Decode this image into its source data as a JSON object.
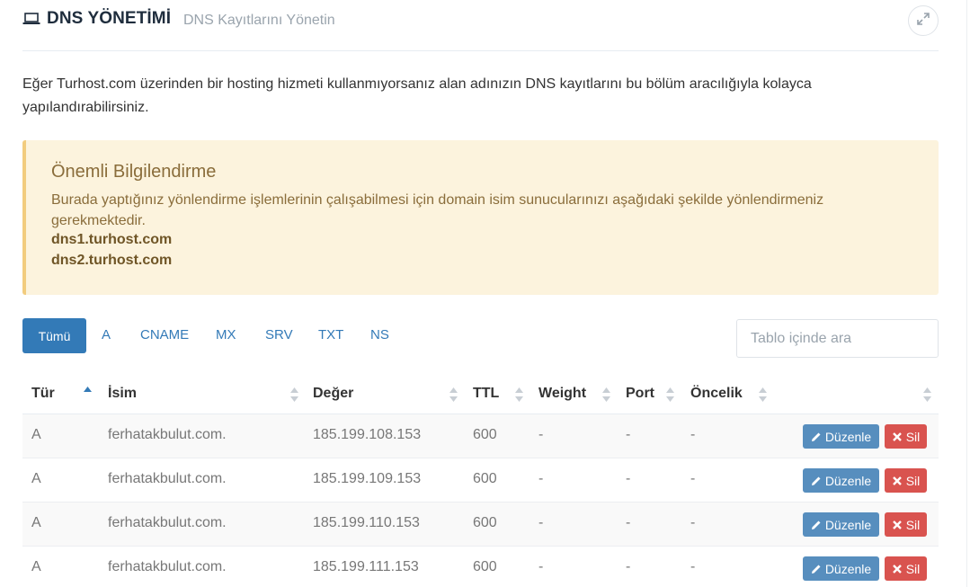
{
  "header": {
    "title": "DNS YÖNETİMİ",
    "subtitle": "DNS Kayıtlarını Yönetin",
    "icon": "laptop-icon",
    "expand_icon": "expand-icon"
  },
  "intro": "Eğer Turhost.com üzerinden bir hosting hizmeti kullanmıyorsanız alan adınızın DNS kayıtlarını bu bölüm aracılığıyla kolayca yapılandırabilirsiniz.",
  "alert": {
    "title": "Önemli Bilgilendirme",
    "text": "Burada yaptığınız yönlendirme işlemlerinin çalışabilmesi için domain isim sunucularınızı aşağıdaki şekilde yönlendirmeniz gerekmektedir.",
    "ns1": "dns1.turhost.com",
    "ns2": "dns2.turhost.com"
  },
  "filters": [
    "Tümü",
    "A",
    "CNAME",
    "MX",
    "SRV",
    "TXT",
    "NS"
  ],
  "search": {
    "placeholder": "Tablo içinde ara"
  },
  "table": {
    "headers": [
      "Tür",
      "İsim",
      "Değer",
      "TTL",
      "Weight",
      "Port",
      "Öncelik"
    ],
    "sorted_column": "Tür",
    "rows": [
      {
        "type": "A",
        "name": "ferhatakbulut.com.",
        "value": "185.199.108.153",
        "ttl": "600",
        "weight": "-",
        "port": "-",
        "priority": "-"
      },
      {
        "type": "A",
        "name": "ferhatakbulut.com.",
        "value": "185.199.109.153",
        "ttl": "600",
        "weight": "-",
        "port": "-",
        "priority": "-"
      },
      {
        "type": "A",
        "name": "ferhatakbulut.com.",
        "value": "185.199.110.153",
        "ttl": "600",
        "weight": "-",
        "port": "-",
        "priority": "-"
      },
      {
        "type": "A",
        "name": "ferhatakbulut.com.",
        "value": "185.199.111.153",
        "ttl": "600",
        "weight": "-",
        "port": "-",
        "priority": "-"
      }
    ],
    "edit_label": "Düzenle",
    "delete_label": "Sil",
    "edit_icon": "pencil-icon",
    "delete_icon": "times-icon"
  },
  "colors": {
    "primary": "#337ab7",
    "edit_button": "#578ebe",
    "delete_button": "#d9534f",
    "alert_bg": "#fcf3dd",
    "alert_border": "#f2cc7e",
    "alert_text": "#8a6d3b"
  }
}
